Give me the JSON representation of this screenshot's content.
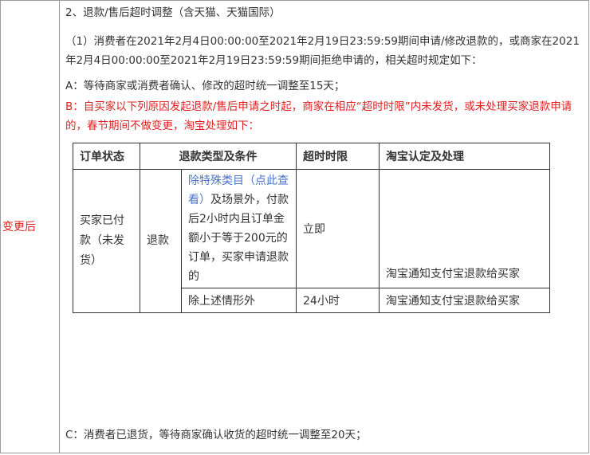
{
  "side_label": "变更后",
  "section_title": "2、退款/售后超时调整（含天猫、天猫国际）",
  "paragraph_1": "（1）消费者在2021年2月4日00:00:00至2021年2月19日23:59:59期间申请/修改退款的，或商家在2021年2月4日00:00:00至2021年2月19日23:59:59期间拒绝申请的，相关超时规定如下：",
  "item_a": "A：等待商家或消费者确认、修改的超时统一调整至15天；",
  "item_b": "B：自买家以下列原因发起退款/售后申请之时起，商家在相应“超时时限”内未发货，或未处理买家退款申请的，春节期间不做变更，淘宝处理如下：",
  "item_c": "C：消费者已退货，等待商家确认收货的超时统一调整至20天；",
  "table": {
    "headers": [
      "订单状态",
      "退款类型及条件",
      "超时时限",
      "淘宝认定及处理"
    ],
    "order_status": "买家已付款（未发货）",
    "refund_type": "退款",
    "row1": {
      "condition_link": "除特殊类目（点此查看）",
      "condition_text": "及场景外，付款后2小时内且订单金额小于等于200元的订单，买家申请退款的",
      "time_limit": "立即",
      "handling": "淘宝通知支付宝退款给买家"
    },
    "row2": {
      "condition_text": "除上述情形外",
      "time_limit": "24小时",
      "handling": "淘宝通知支付宝退款给买家"
    }
  },
  "colors": {
    "red": "#e02020",
    "link": "#4a74c9",
    "text": "#333333",
    "border": "#9a9a9a"
  }
}
